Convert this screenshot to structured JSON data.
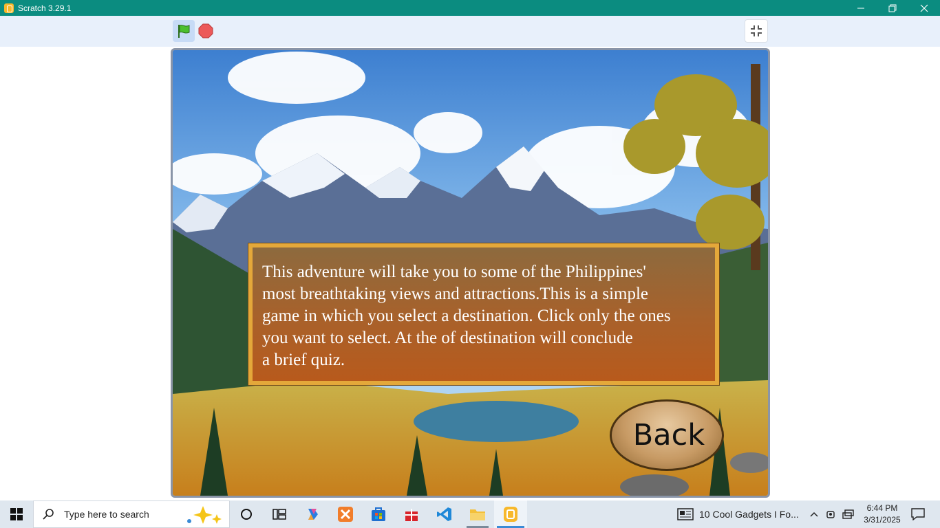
{
  "window": {
    "title": "Scratch 3.29.1",
    "titlebar_color": "#0b8c80"
  },
  "toolbar": {
    "green_flag_icon": "green-flag",
    "stop_icon": "stop-sign",
    "fullscreen_icon": "exit-fullscreen"
  },
  "stage": {
    "background": "mountain lake landscape",
    "info_text": "This adventure will take you to some of the Philippines'\nmost breathtaking views and attractions.This is a simple\ngame in which you select a destination. Click only the ones\nyou want to select. At the of destination will conclude\na brief quiz.",
    "back_label": "Back"
  },
  "taskbar": {
    "search_placeholder": "Type here to search",
    "news_text": "10 Cool Gadgets I Fo...",
    "time": "6:44 PM",
    "date": "3/31/2025",
    "apps": [
      "cortana",
      "task-view",
      "copilot",
      "xampp",
      "microsoft-store",
      "gift",
      "vscode",
      "file-explorer",
      "scratch"
    ]
  }
}
